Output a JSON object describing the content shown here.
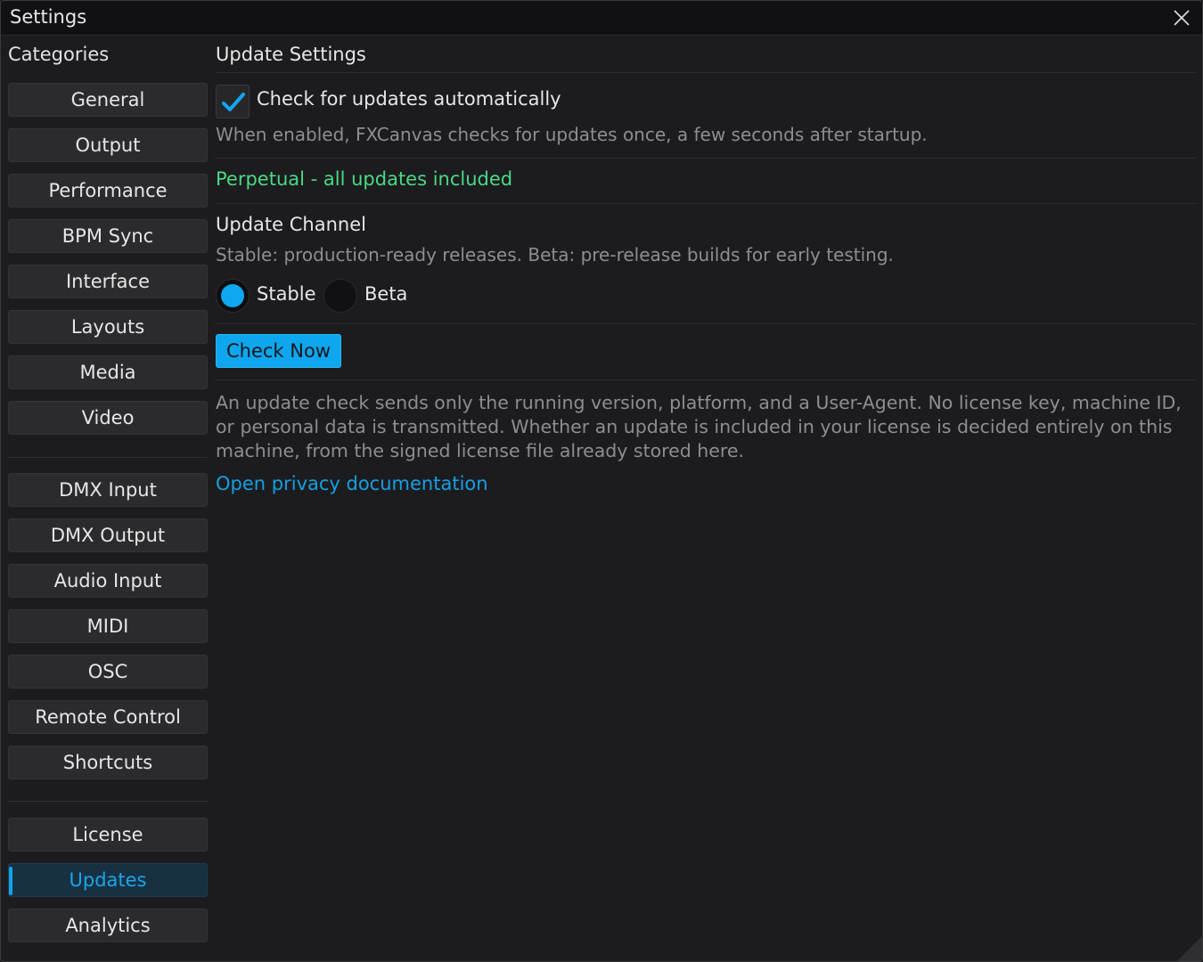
{
  "window": {
    "title": "Settings"
  },
  "sidebar": {
    "heading": "Categories",
    "group1": [
      "General",
      "Output",
      "Performance",
      "BPM Sync",
      "Interface",
      "Layouts",
      "Media",
      "Video"
    ],
    "group2": [
      "DMX Input",
      "DMX Output",
      "Audio Input",
      "MIDI",
      "OSC",
      "Remote Control",
      "Shortcuts"
    ],
    "group3": [
      "License",
      "Updates",
      "Analytics"
    ],
    "active": "Updates"
  },
  "main": {
    "title": "Update Settings",
    "auto_check": {
      "label": "Check for updates automatically",
      "checked": true,
      "description": "When enabled, FXCanvas checks for updates once, a few seconds after startup."
    },
    "license_status": "Perpetual - all updates included",
    "channel": {
      "title": "Update Channel",
      "description": "Stable: production-ready releases. Beta: pre-release builds for early testing.",
      "options": [
        "Stable",
        "Beta"
      ],
      "selected": "Stable"
    },
    "check_now_label": "Check Now",
    "privacy_text": "An update check sends only the running version, platform, and a User-Agent. No license key, machine ID, or personal data is transmitted. Whether an update is included in your license is decided entirely on this machine, from the signed license file already stored here.",
    "privacy_link": "Open privacy documentation"
  },
  "colors": {
    "accent": "#0ea6ee",
    "status_green": "#4ad985",
    "link": "#159fe3"
  }
}
